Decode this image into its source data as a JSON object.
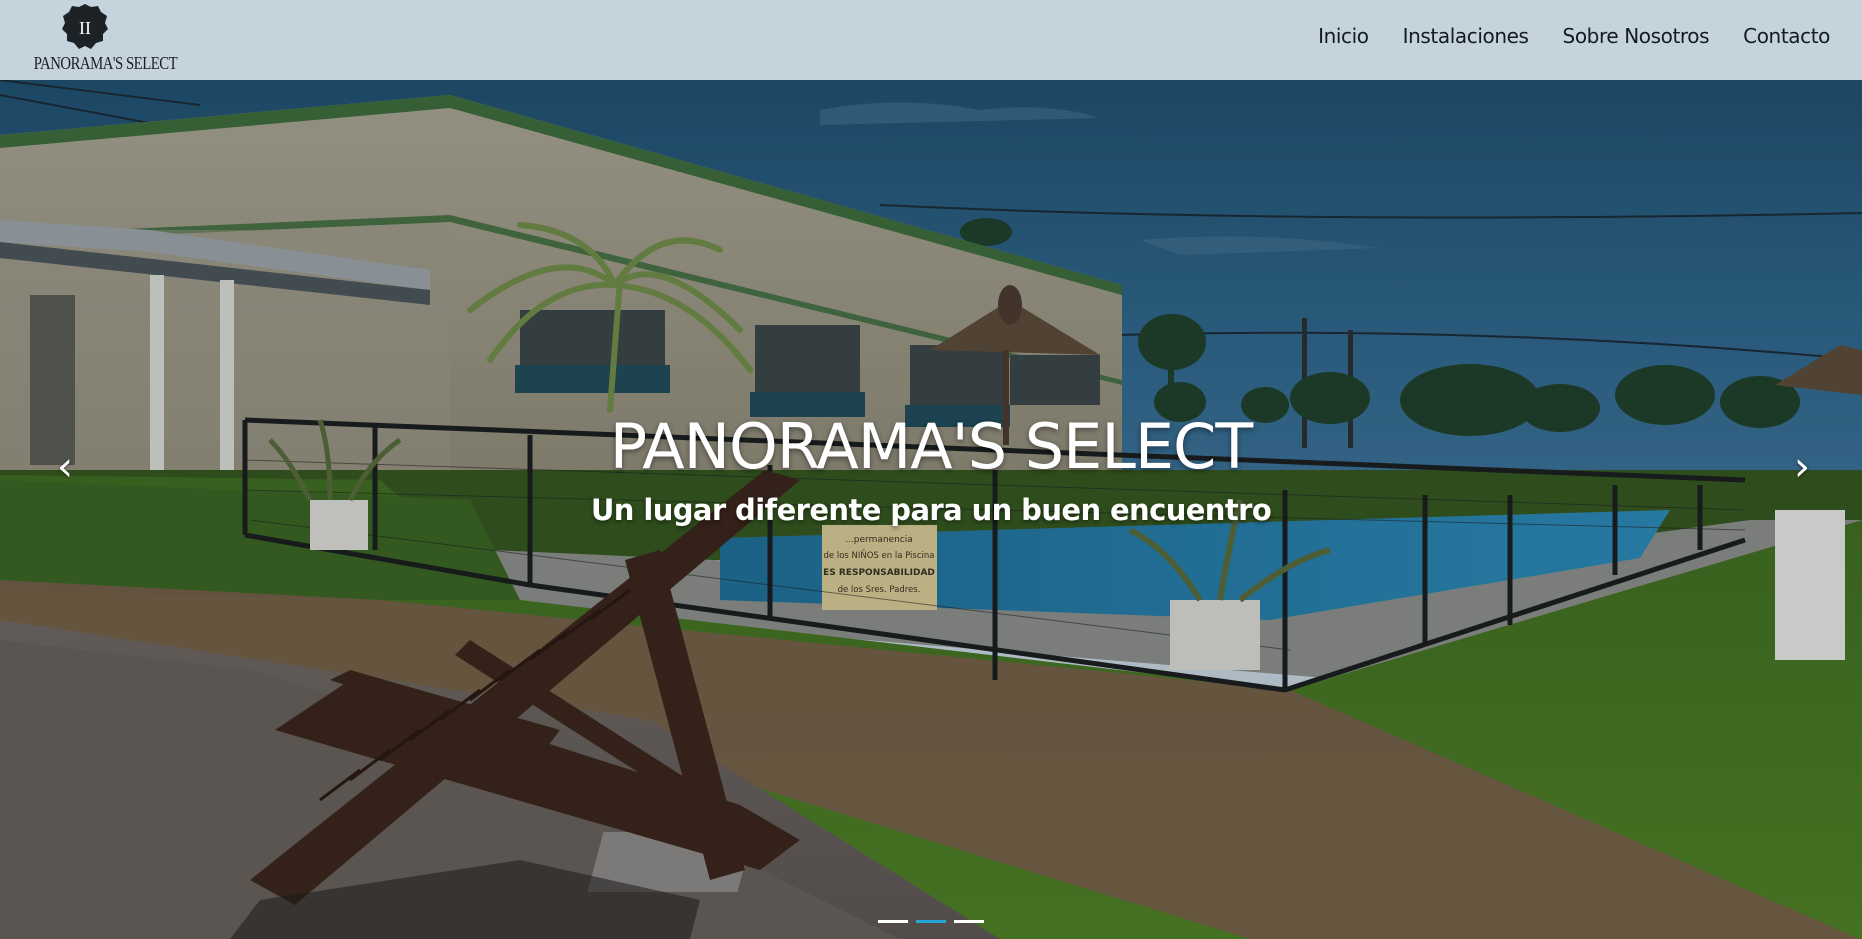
{
  "header": {
    "logo": {
      "brand_text": "PANORAMA'S SELECT",
      "mark_text": "II"
    },
    "nav": {
      "items": [
        {
          "label": "Inicio"
        },
        {
          "label": "Instalaciones"
        },
        {
          "label": "Sobre Nosotros"
        },
        {
          "label": "Contacto"
        }
      ]
    }
  },
  "hero": {
    "title": "PANORAMA'S SELECT",
    "subtitle": "Un lugar diferente para un buen encuentro",
    "prev_arrow": "‹",
    "next_arrow": "›",
    "slides": {
      "count": 3,
      "active_index": 1
    },
    "pool_sign_lines": [
      "...permanencia",
      "de los NIÑOS en la Piscina",
      "ES RESPONSABILIDAD",
      "de los Sres. Padres."
    ]
  },
  "colors": {
    "header_bg": "#c4d3dc",
    "nav_text": "#131b22",
    "indicator_active": "#27a4d6",
    "indicator_inactive": "#ffffff"
  }
}
